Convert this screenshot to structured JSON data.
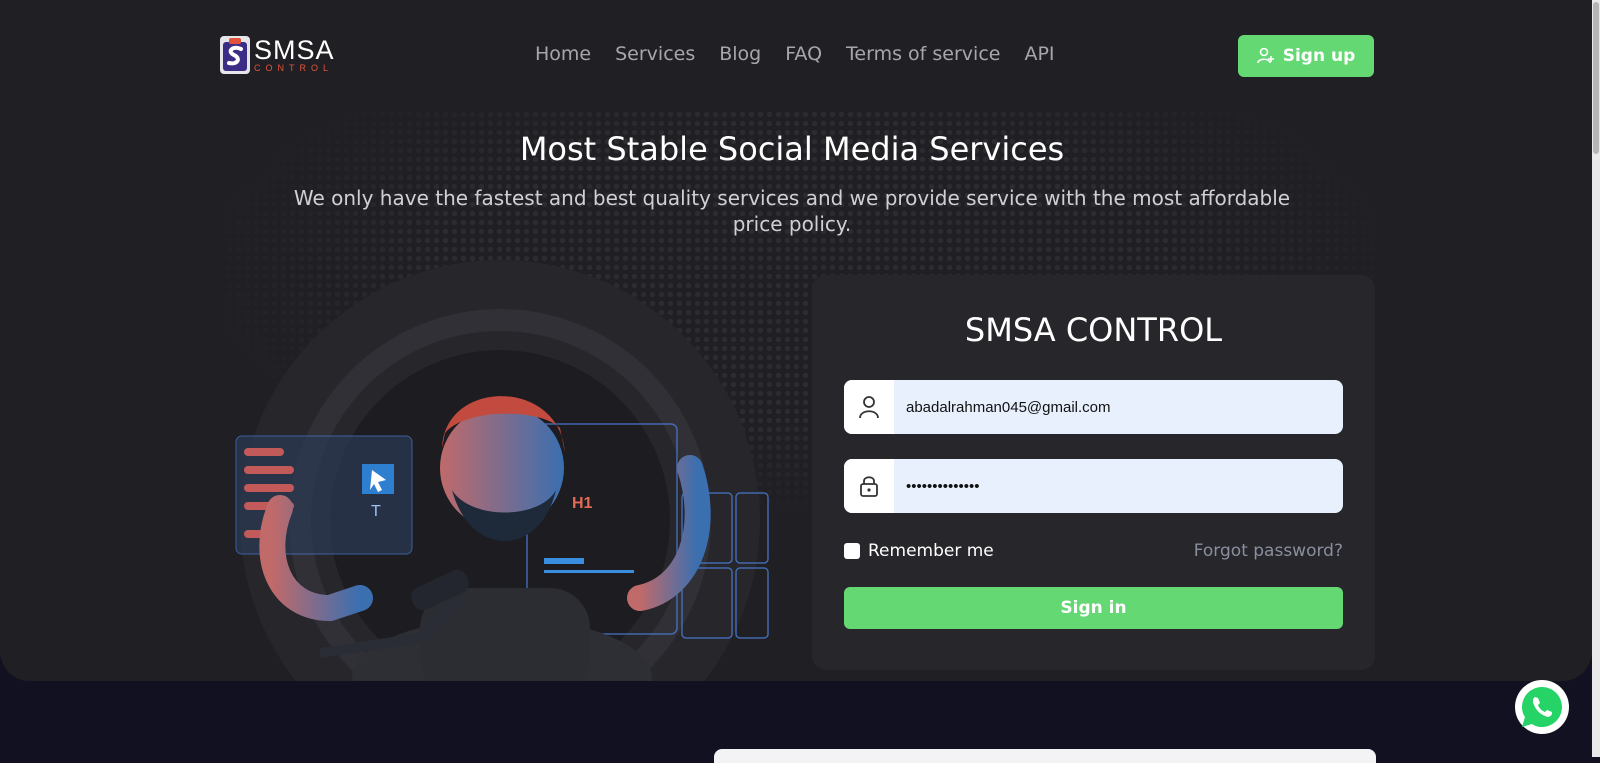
{
  "brand": {
    "name": "SMSA",
    "tagline": "CONTROL"
  },
  "nav": {
    "items": [
      "Home",
      "Services",
      "Blog",
      "FAQ",
      "Terms of service",
      "API"
    ]
  },
  "header": {
    "signup_label": "Sign up"
  },
  "hero": {
    "title": "Most Stable Social Media Services",
    "subtitle": "We only have the fastest and best quality services and we provide service with the most affordable price policy."
  },
  "illustration": {
    "label": "H1"
  },
  "login": {
    "title": "SMSA CONTROL",
    "email_value": "abadalrahman045@gmail.com",
    "password_value": "••••••••••••••",
    "remember_label": "Remember me",
    "forgot_label": "Forgot password?",
    "signin_label": "Sign in"
  },
  "colors": {
    "accent": "#63d873",
    "background": "#202024",
    "card": "#26262b",
    "brand_red": "#e3533b"
  },
  "icons": [
    "user-icon",
    "lock-icon",
    "user-add-icon",
    "whatsapp-icon"
  ]
}
